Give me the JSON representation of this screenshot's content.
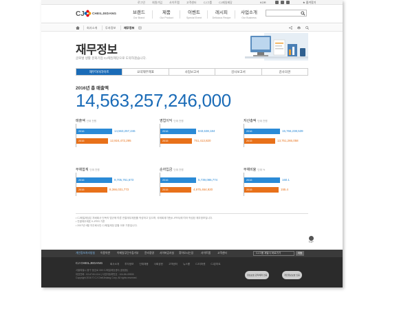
{
  "util_bar": {
    "links": [
      "로그인",
      "회원가입",
      "사이트맵",
      "고객센터",
      "CJ그룹",
      "CJ제일제당",
      "ENG"
    ],
    "lang": "KOR",
    "favorite_label": "즐겨찾기"
  },
  "header": {
    "logo_cj": "CJ",
    "logo_word": "CHEILJEDANG",
    "gnb": [
      {
        "ko": "브랜드",
        "en": "Our Brand"
      },
      {
        "ko": "제품",
        "en": "Our Product"
      },
      {
        "ko": "이벤트",
        "en": "Special Event"
      },
      {
        "ko": "레시피",
        "en": "Delicious Recipe"
      },
      {
        "ko": "사업소개",
        "en": "Our Business"
      }
    ],
    "search_placeholder": ""
  },
  "breadcrumb": [
    "회사소개",
    "투자정보",
    "재무정보"
  ],
  "page": {
    "title": "재무정보",
    "subtitle": "글로벌 생활 문화기업 CJ제일제당으로 도약하겠습니다."
  },
  "tabs": [
    "재무하이라이트",
    "요약재무제표",
    "사업보고서",
    "감사보고서",
    "감사의견"
  ],
  "sales": {
    "label": "2016년 총 매출액",
    "value": "14,563,257,246,000"
  },
  "colors": {
    "accent": "#1a6bb7",
    "series_2016": "#2a8ad6",
    "series_2015": "#e8711a"
  },
  "chart_data": [
    {
      "type": "bar",
      "title": "매출액",
      "unit": "단위 천원",
      "series": [
        {
          "name": "2016",
          "value": 14563257246,
          "label": "14,563,257,246"
        },
        {
          "name": "2015",
          "value": 12924472295,
          "label": "12,924,472,295"
        }
      ]
    },
    {
      "type": "bar",
      "title": "영업이익",
      "unit": "단위 천원",
      "series": [
        {
          "name": "2016",
          "value": 843638184,
          "label": "843,638,184"
        },
        {
          "name": "2015",
          "value": 751413820,
          "label": "751,413,820"
        }
      ]
    },
    {
      "type": "bar",
      "title": "자산총액",
      "unit": "단위 천원",
      "series": [
        {
          "name": "2016",
          "value": 15766238539,
          "label": "15,766,238,539"
        },
        {
          "name": "2015",
          "value": 13751265058,
          "label": "13,751,265,058"
        }
      ]
    },
    {
      "type": "bar",
      "title": "부채합계",
      "unit": "단위 천원",
      "series": [
        {
          "name": "2016",
          "value": 9705761673,
          "label": "9,705,761,673"
        },
        {
          "name": "2015",
          "value": 8366031773,
          "label": "8,366,031,773"
        }
      ]
    },
    {
      "type": "bar",
      "title": "순자입금",
      "unit": "단위 천원",
      "series": [
        {
          "name": "2016",
          "value": 5739086774,
          "label": "5,739,086,774"
        },
        {
          "name": "2015",
          "value": 4975464920,
          "label": "4,975,464,920"
        }
      ]
    },
    {
      "type": "bar",
      "title": "부채비율",
      "unit": "단위 %",
      "series": [
        {
          "name": "2016",
          "value": 160.1,
          "label": "160.1"
        },
        {
          "name": "2015",
          "value": 155.4,
          "label": "155.4"
        }
      ]
    }
  ],
  "notes": [
    "• CJ제일제당은 지배회사 단독의 법규에 따른 연결재무제표를 작성하고 있으며, 국제회계기준(K-IFRS)에 따라 작성된 재무정보입니다.",
    "• 연결재무제표 K-IFRS 기준",
    "• 2007년 9월 지주회사인 CJ제일제당 분할 이후 기준입니다."
  ],
  "top_label": "TOP",
  "footer_nav": {
    "items": [
      "개인정보처리방침",
      "이용약관",
      "이메일무단수집거부",
      "윤리경영",
      "사이버감사실",
      "찾아오시는길",
      "사이트맵",
      "고객센터"
    ],
    "family_select": "CJ그룹 계열사 바로가기",
    "go_label": "이동"
  },
  "footer": {
    "logo": "CJ CHEILJEDANG",
    "links": [
      "회사소개",
      "투자정보",
      "인재채용",
      "사회공헌",
      "고객센터",
      "뉴스룸",
      "CJ더마켓",
      "CJ온마트"
    ],
    "address": [
      "서울특별시 중구 동호로 330 CJ제일제당센터 (쌍림동)",
      "대표전화 : 02-6740-1114  |  사업자등록번호 : 104-86-09535",
      "Copyright 2016 © CJ CheilJedang Corp. All rights reserved."
    ],
    "badges": [
      "정보보호 관리체계 인증",
      "개인정보보호 인증"
    ]
  }
}
